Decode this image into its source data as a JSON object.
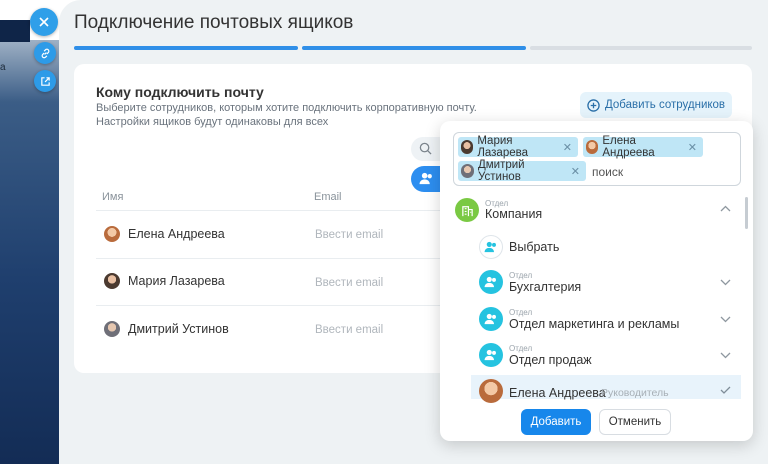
{
  "sidebar": {
    "fragment": "а"
  },
  "page": {
    "title": "Подключение почтовых ящиков",
    "progress_colors": [
      "#2f8fe8",
      "#2f8fe8",
      "#d9dee3"
    ]
  },
  "section": {
    "title": "Кому подключить почту",
    "subtitle_1": "Выберите сотрудников, которым хотите подключить корпоративную почту.",
    "subtitle_2": "Настройки ящиков будут одинаковы для всех",
    "add_button": "Добавить сотрудников"
  },
  "table": {
    "col_name": "Имя",
    "col_email": "Email",
    "rows": [
      {
        "name": "Елена Андреева",
        "email_placeholder": "Ввести email"
      },
      {
        "name": "Мария Лазарева",
        "email_placeholder": "Ввести email"
      },
      {
        "name": "Дмитрий Устинов",
        "email_placeholder": "Ввести email"
      }
    ]
  },
  "dialog": {
    "chips": [
      "Мария Лазарева",
      "Елена Андреева",
      "Дмитрий Устинов"
    ],
    "search_placeholder": "поиск",
    "company": {
      "small": "Отдел",
      "name": "Компания"
    },
    "select_label": "Выбрать",
    "departments": [
      {
        "small": "Отдел",
        "name": "Бухгалтерия"
      },
      {
        "small": "Отдел",
        "name": "Отдел маркетинга и рекламы"
      },
      {
        "small": "Отдел",
        "name": "Отдел продаж"
      }
    ],
    "highlight": {
      "name": "Елена Андреева",
      "role": "Руководитель"
    },
    "add_label": "Добавить",
    "cancel_label": "Отменить"
  },
  "colors": {
    "accent": "#1787eb",
    "company_icon": "#7ac943",
    "dept_icon": "#25c3e0"
  }
}
